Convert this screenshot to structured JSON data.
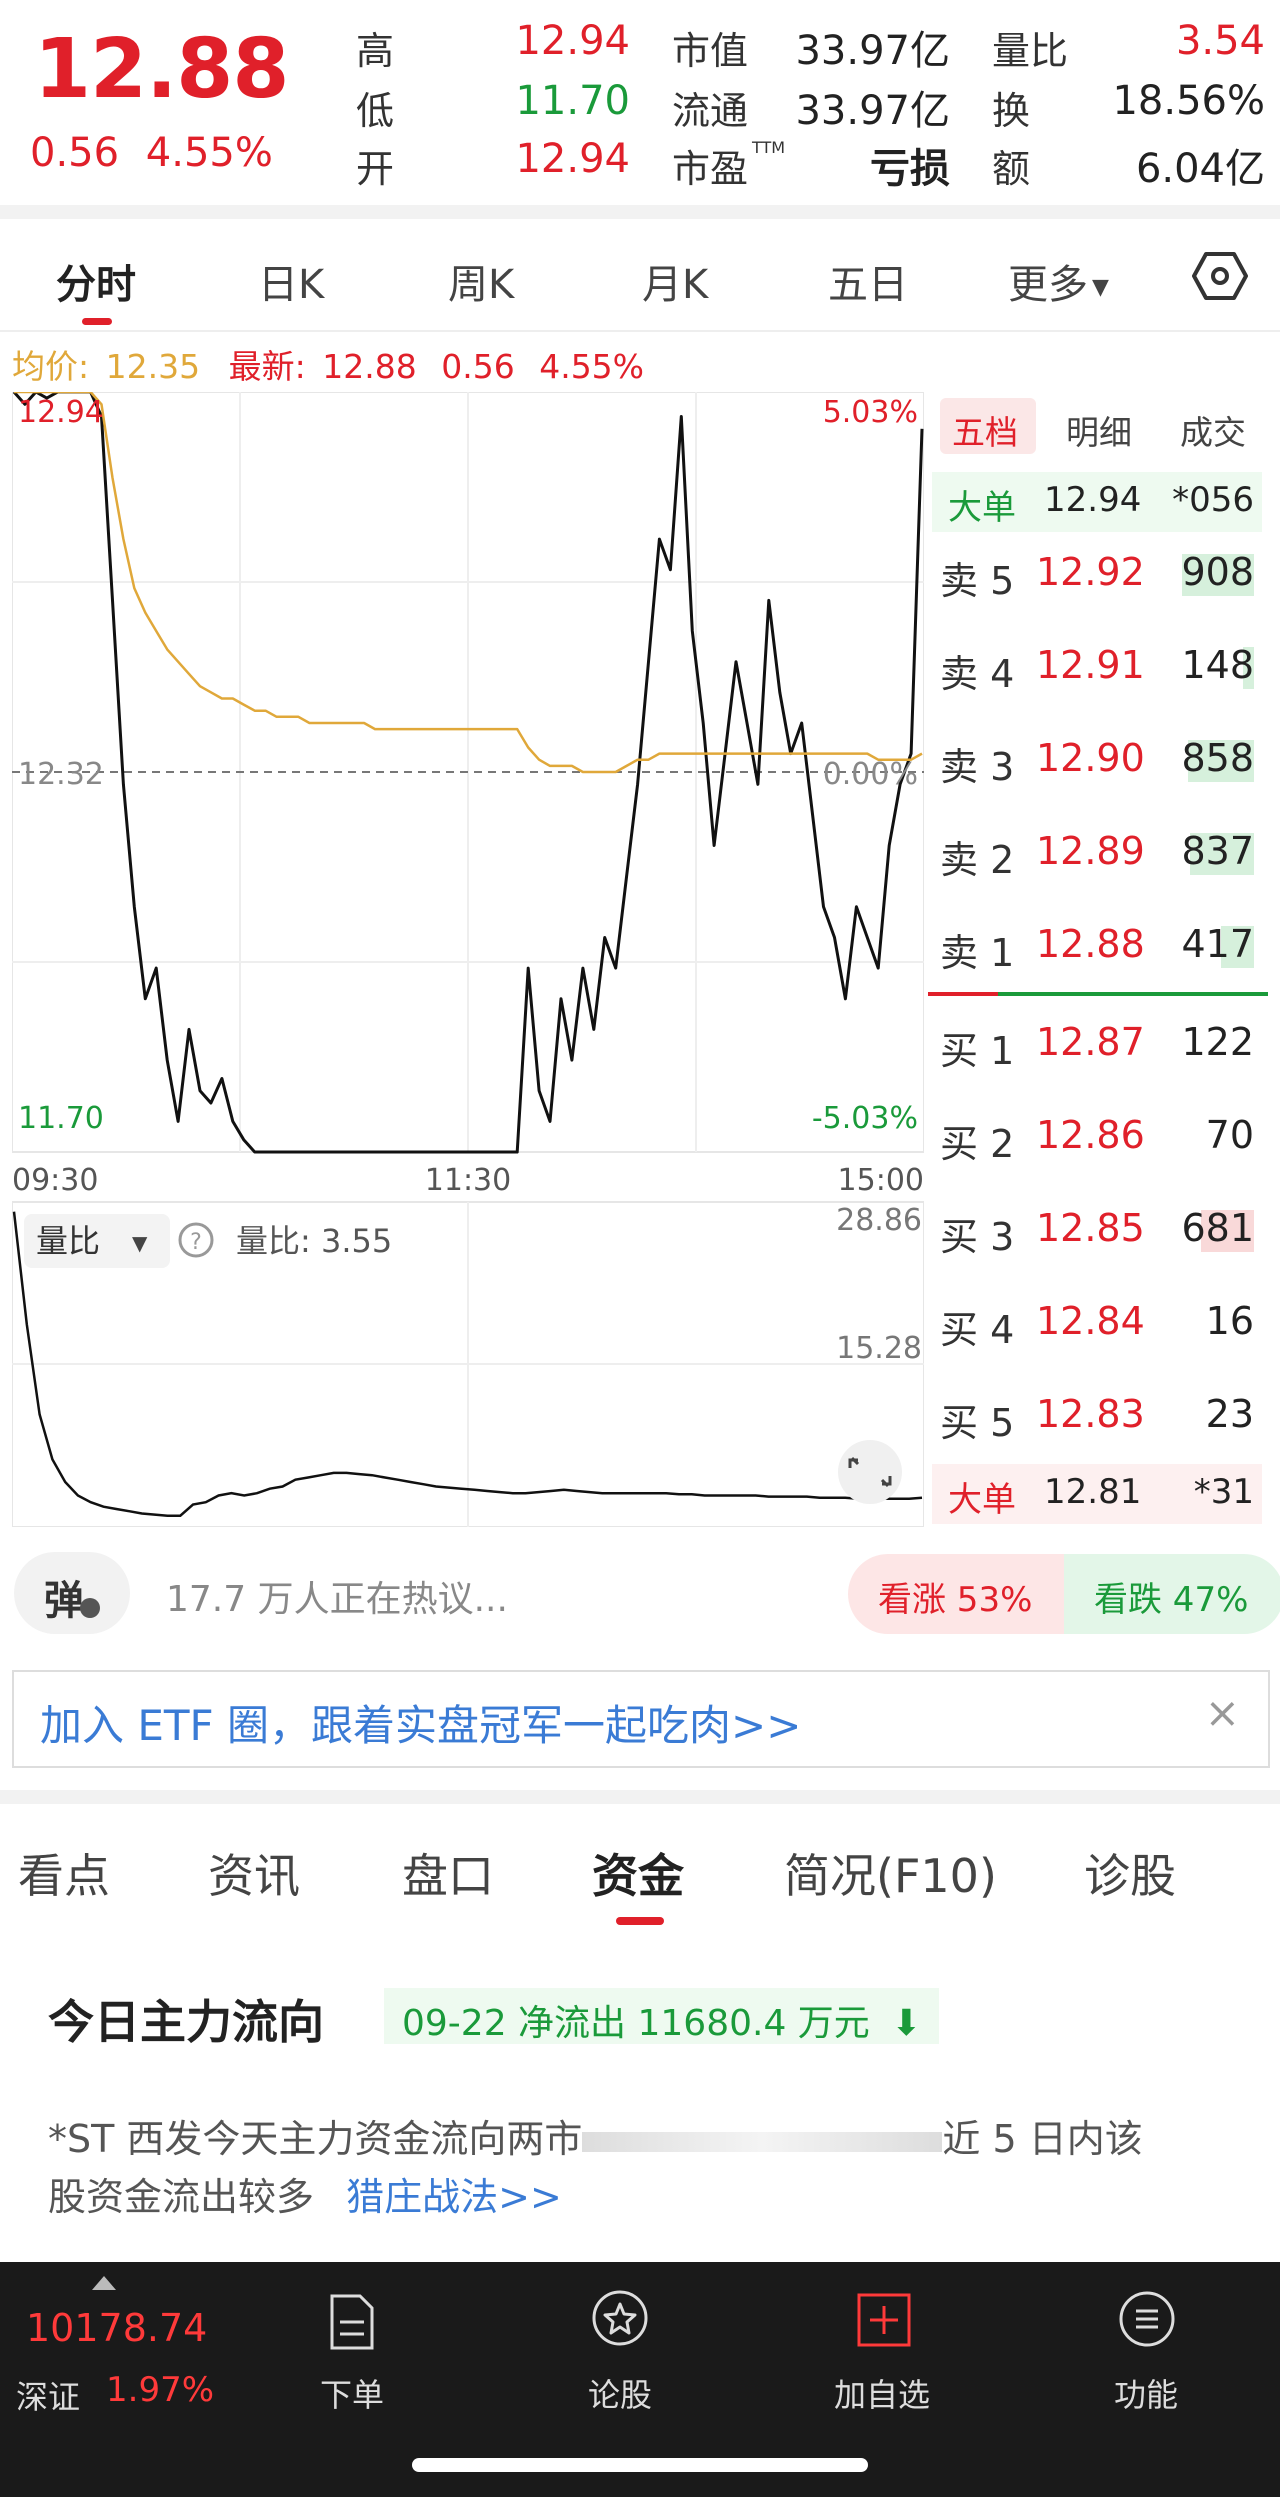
{
  "quote": {
    "price": "12.88",
    "change": "0.56",
    "change_pct": "4.55%",
    "stats": [
      {
        "label": "高",
        "value": "12.94",
        "color": "#e0202a"
      },
      {
        "label": "低",
        "value": "11.70",
        "color": "#1a9a3a"
      },
      {
        "label": "开",
        "value": "12.94",
        "color": "#e0202a"
      },
      {
        "label": "市值",
        "value": "33.97亿",
        "color": "#222222"
      },
      {
        "label": "流通",
        "value": "33.97亿",
        "color": "#222222"
      },
      {
        "label": "市盈",
        "label_sup": "TTM",
        "value": "亏损",
        "color": "#222222"
      },
      {
        "label": "量比",
        "value": "3.54",
        "color": "#e0202a"
      },
      {
        "label": "换",
        "value": "18.56%",
        "color": "#222222"
      },
      {
        "label": "额",
        "value": "6.04亿",
        "color": "#222222"
      }
    ]
  },
  "tabs": {
    "items": [
      "分时",
      "日K",
      "周K",
      "月K",
      "五日",
      "更多"
    ],
    "active": "分时"
  },
  "avg_row": {
    "avg_label": "均价:",
    "avg_value": "12.35",
    "latest_label": "最新:",
    "latest_value": "12.88",
    "latest_change": "0.56",
    "latest_pct": "4.55%"
  },
  "chart_labels": {
    "y_high": "12.94",
    "y_mid": "12.32",
    "y_low": "11.70",
    "pct_high": "5.03%",
    "pct_mid": "0.00%",
    "pct_low": "-5.03%",
    "x_start": "09:30",
    "x_mid": "11:30",
    "x_end": "15:00",
    "vol_dropdown": "量比",
    "vol_value_label": "量比: 3.55",
    "vol_max": "28.86",
    "vol_mid": "15.28"
  },
  "chart_data": [
    {
      "type": "line",
      "ylim": [
        11.7,
        12.94
      ],
      "series": [
        {
          "values": [
            12.94,
            12.92,
            12.94,
            12.93,
            12.94,
            12.94,
            12.94,
            12.94,
            12.9,
            12.6,
            12.3,
            12.1,
            11.95,
            12.0,
            11.85,
            11.75,
            11.9,
            11.8,
            11.78,
            11.82,
            11.75,
            11.72,
            11.7,
            11.7,
            11.7,
            11.7,
            11.7,
            11.7,
            11.7,
            11.7,
            11.7,
            11.7,
            11.7,
            11.7,
            11.7,
            11.7,
            11.7,
            11.7,
            11.7,
            11.7,
            11.7,
            11.7,
            11.7,
            11.7,
            11.7,
            11.7,
            11.7,
            12.0,
            11.8,
            11.75,
            11.95,
            11.85,
            12.0,
            11.9,
            12.05,
            12.0,
            12.15,
            12.3,
            12.5,
            12.7,
            12.65,
            12.9,
            12.55,
            12.4,
            12.2,
            12.35,
            12.5,
            12.4,
            12.3,
            12.6,
            12.45,
            12.35,
            12.4,
            12.25,
            12.1,
            12.05,
            11.95,
            12.1,
            12.05,
            12.0,
            12.2,
            12.3,
            12.35,
            12.88
          ]
        },
        {
          "values": [
            12.94,
            12.94,
            12.94,
            12.94,
            12.94,
            12.94,
            12.94,
            12.94,
            12.92,
            12.8,
            12.7,
            12.62,
            12.58,
            12.55,
            12.52,
            12.5,
            12.48,
            12.46,
            12.45,
            12.44,
            12.44,
            12.43,
            12.42,
            12.42,
            12.41,
            12.41,
            12.41,
            12.4,
            12.4,
            12.4,
            12.4,
            12.4,
            12.4,
            12.39,
            12.39,
            12.39,
            12.39,
            12.39,
            12.39,
            12.39,
            12.39,
            12.39,
            12.39,
            12.39,
            12.39,
            12.39,
            12.39,
            12.36,
            12.34,
            12.33,
            12.33,
            12.33,
            12.32,
            12.32,
            12.32,
            12.32,
            12.33,
            12.34,
            12.34,
            12.35,
            12.35,
            12.35,
            12.35,
            12.35,
            12.35,
            12.35,
            12.35,
            12.35,
            12.35,
            12.35,
            12.35,
            12.35,
            12.35,
            12.35,
            12.35,
            12.35,
            12.35,
            12.35,
            12.35,
            12.34,
            12.34,
            12.34,
            12.34,
            12.35
          ]
        }
      ]
    },
    {
      "type": "line",
      "ylim": [
        0,
        28.86
      ],
      "series": [
        {
          "values": [
            28.0,
            18.0,
            10.0,
            6.0,
            4.0,
            2.8,
            2.2,
            1.8,
            1.6,
            1.4,
            1.2,
            1.1,
            1.0,
            1.0,
            2.0,
            2.2,
            2.8,
            3.0,
            2.8,
            3.0,
            3.4,
            3.6,
            4.2,
            4.4,
            4.6,
            4.8,
            4.8,
            4.7,
            4.6,
            4.4,
            4.2,
            4.0,
            3.8,
            3.6,
            3.5,
            3.4,
            3.3,
            3.2,
            3.1,
            3.0,
            3.0,
            3.1,
            3.2,
            3.3,
            3.2,
            3.1,
            3.0,
            3.0,
            3.0,
            3.0,
            3.0,
            3.0,
            2.9,
            2.9,
            2.8,
            2.8,
            2.8,
            2.8,
            2.8,
            2.7,
            2.7,
            2.7,
            2.7,
            2.6,
            2.6,
            2.6,
            2.5,
            2.5,
            2.5,
            2.5,
            2.5,
            2.6
          ]
        }
      ]
    }
  ],
  "orderbook": {
    "tabs": [
      "五档",
      "明细",
      "成交"
    ],
    "big_top": {
      "label": "大单",
      "price": "12.94",
      "vol": "*056"
    },
    "sells": [
      {
        "label": "卖 5",
        "price": "12.92",
        "vol": "908",
        "bar": 0.65
      },
      {
        "label": "卖 4",
        "price": "12.91",
        "vol": "148",
        "bar": 0.1
      },
      {
        "label": "卖 3",
        "price": "12.90",
        "vol": "858",
        "bar": 0.6
      },
      {
        "label": "卖 2",
        "price": "12.89",
        "vol": "837",
        "bar": 0.58
      },
      {
        "label": "卖 1",
        "price": "12.88",
        "vol": "417",
        "bar": 0.3
      }
    ],
    "buys": [
      {
        "label": "买 1",
        "price": "12.87",
        "vol": "122",
        "bar": 0.1
      },
      {
        "label": "买 2",
        "price": "12.86",
        "vol": "70",
        "bar": 0.05
      },
      {
        "label": "买 3",
        "price": "12.85",
        "vol": "681",
        "bar": 0.48
      },
      {
        "label": "买 4",
        "price": "12.84",
        "vol": "16",
        "bar": 0.02
      },
      {
        "label": "买 5",
        "price": "12.83",
        "vol": "23",
        "bar": 0.03
      }
    ],
    "big_bottom": {
      "label": "大单",
      "price": "12.81",
      "vol": "*31"
    }
  },
  "danmu": {
    "icon_text": "弹",
    "hot_text": "17.7 万人正在热议...",
    "bull": "看涨 53%",
    "bear": "看跌 47%"
  },
  "etf_banner": {
    "text": "加入 ETF 圈，跟着实盘冠军一起吃肉>>"
  },
  "subtabs": {
    "items": [
      "看点",
      "资讯",
      "盘口",
      "资金",
      "简况(F10)",
      "诊股"
    ],
    "active": "资金"
  },
  "fund_flow": {
    "title": "今日主力流向",
    "badge": "09-22 净流出 11680.4 万元",
    "line1_start": "*ST 西发今天主力资金流向两市",
    "line1_end": "近 5 日内该",
    "line2": "股资金流出较多",
    "link": "猎庄战法>>"
  },
  "bottom_nav": {
    "index_value": "10178.74",
    "index_name": "深证",
    "index_pct": "1.97%",
    "items": [
      "下单",
      "论股",
      "加自选",
      "功能"
    ]
  },
  "colors": {
    "red": "#e0202a",
    "green": "#1a9a3a",
    "avg_line": "#e0a83a",
    "nav_bg": "#1a1a1a"
  }
}
